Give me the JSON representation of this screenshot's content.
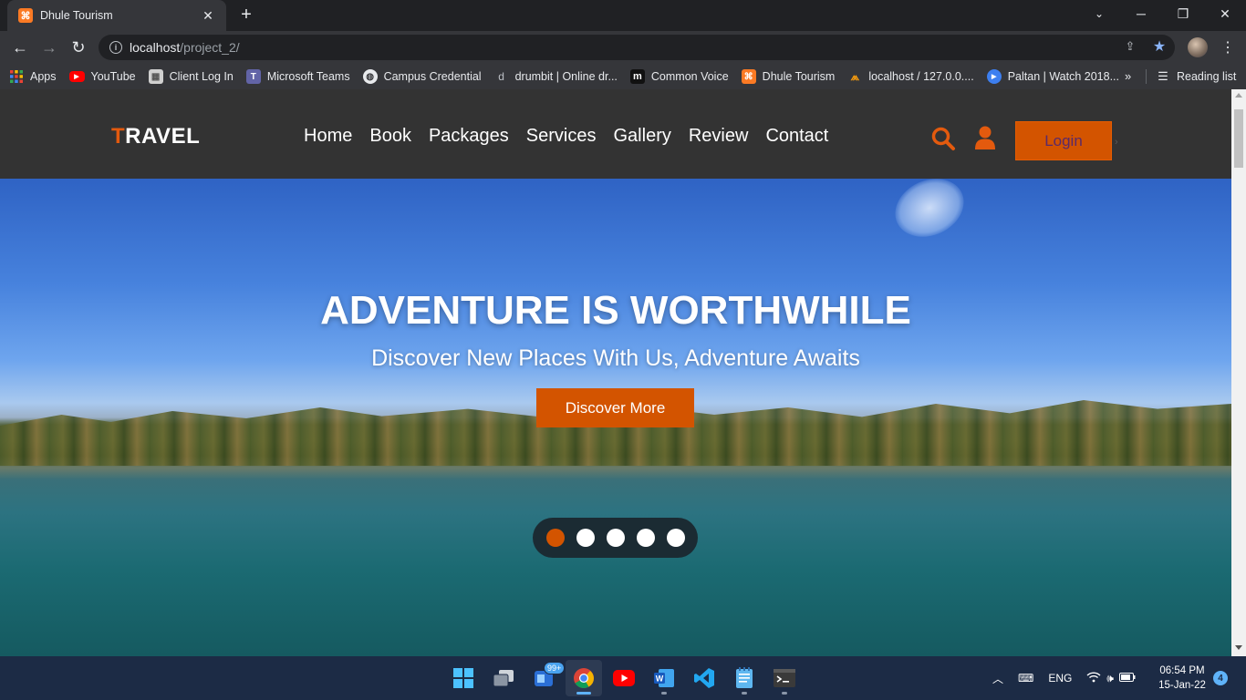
{
  "browser": {
    "tab_title": "Dhule Tourism",
    "url_host": "localhost",
    "url_path": "/project_2/",
    "bookmarks": [
      {
        "label": "Apps",
        "icon": "apps-grid-icon",
        "color": "#e8453c"
      },
      {
        "label": "YouTube",
        "icon": "youtube-icon",
        "color": "#ff0000"
      },
      {
        "label": "Client Log In",
        "icon": "client-login-icon",
        "color": "#d0d0d0"
      },
      {
        "label": "Microsoft Teams",
        "icon": "teams-icon",
        "color": "#6264a7"
      },
      {
        "label": "Campus Credential",
        "icon": "globe-icon",
        "color": "#e8eaed"
      },
      {
        "label": "drumbit | Online dr...",
        "icon": "drumbit-icon",
        "color": "#35363a"
      },
      {
        "label": "Common Voice",
        "icon": "common-voice-icon",
        "color": "#111111"
      },
      {
        "label": "Dhule Tourism",
        "icon": "xampp-icon",
        "color": "#fb7a24"
      },
      {
        "label": "localhost / 127.0.0....",
        "icon": "phpmyadmin-icon",
        "color": "#f89c0e"
      },
      {
        "label": "Paltan | Watch 2018...",
        "icon": "play-icon",
        "color": "#3d7ff0"
      }
    ],
    "more_bookmarks": "»",
    "reading_list": "Reading list"
  },
  "site": {
    "logo_first": "T",
    "logo_rest": "RAVEL",
    "menu": [
      "Home",
      "Book",
      "Packages",
      "Services",
      "Gallery",
      "Review",
      "Contact"
    ],
    "login_label": "Login",
    "accent": "#d35400"
  },
  "hero": {
    "title": "ADVENTURE IS WORTHWHILE",
    "subtitle": "Discover New Places With Us, Adventure Awaits",
    "cta": "Discover More",
    "slides": 5,
    "active_slide": 1
  },
  "taskbar": {
    "apps": [
      {
        "name": "start-icon",
        "active": false,
        "running": false
      },
      {
        "name": "task-view-icon",
        "active": false,
        "running": false
      },
      {
        "name": "widgets-icon",
        "active": false,
        "running": false,
        "badge": "99+"
      },
      {
        "name": "chrome-icon",
        "active": true,
        "running": true
      },
      {
        "name": "youtube-app-icon",
        "active": false,
        "running": false
      },
      {
        "name": "word-icon",
        "active": false,
        "running": true
      },
      {
        "name": "vscode-icon",
        "active": false,
        "running": false
      },
      {
        "name": "notepad-icon",
        "active": false,
        "running": true
      },
      {
        "name": "terminal-icon",
        "active": false,
        "running": true
      }
    ],
    "language": "ENG",
    "time": "06:54 PM",
    "date": "15-Jan-22",
    "notifications": "4"
  }
}
